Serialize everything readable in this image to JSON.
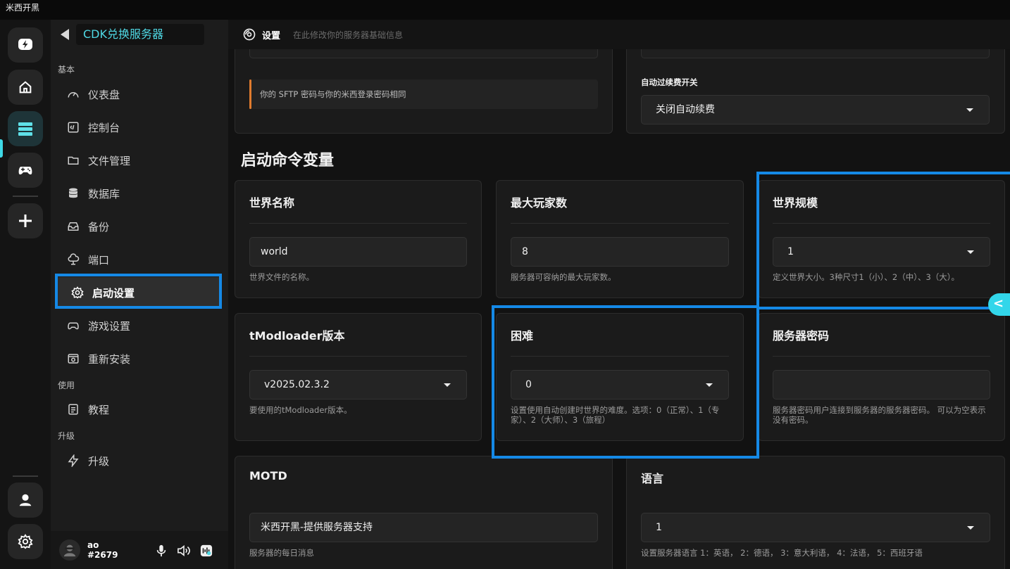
{
  "window": {
    "title": "米西开黑"
  },
  "rail": {
    "items": [
      "lightning",
      "home",
      "servers",
      "games",
      "add",
      "account",
      "settings"
    ]
  },
  "nav": {
    "header": "CDK兑换服务器",
    "sections": {
      "basic": "基本",
      "use": "使用",
      "upgrade": "升级"
    },
    "items": [
      {
        "label": "仪表盘",
        "icon": "gauge-icon"
      },
      {
        "label": "控制台",
        "icon": "console-icon"
      },
      {
        "label": "文件管理",
        "icon": "folder-icon"
      },
      {
        "label": "数据库",
        "icon": "database-icon"
      },
      {
        "label": "备份",
        "icon": "backup-icon"
      },
      {
        "label": "端口",
        "icon": "cloud-port-icon"
      },
      {
        "label": "启动设置",
        "icon": "gear-icon",
        "selected": true
      },
      {
        "label": "游戏设置",
        "icon": "gamepad-icon"
      },
      {
        "label": "重新安装",
        "icon": "reinstall-icon"
      },
      {
        "label": "教程",
        "icon": "tutorial-icon"
      },
      {
        "label": "升级",
        "icon": "bolt-icon"
      }
    ]
  },
  "user": {
    "name": "ao",
    "tag": "#2679"
  },
  "page": {
    "title": "设置",
    "subtitle": "在此修改你的服务器基础信息"
  },
  "top": {
    "sftp_notice": "你的 SFTP 密码与你的米西登录密码相同",
    "auto_renew_label": "自动过续费开关",
    "auto_renew_value": "关闭自动续费"
  },
  "section_title": "启动命令变量",
  "variables": {
    "world_name": {
      "label": "世界名称",
      "value": "world",
      "hint": "世界文件的名称。"
    },
    "max_players": {
      "label": "最大玩家数",
      "value": "8",
      "hint": "服务器可容纳的最大玩家数。"
    },
    "world_size": {
      "label": "世界规模",
      "value": "1",
      "hint": "定义世界大小。3种尺寸1（小）、2（中）、3（大）。"
    },
    "tmod_version": {
      "label": "tModloader版本",
      "value": "v2025.02.3.2",
      "hint": "要使用的tModloader版本。"
    },
    "difficulty": {
      "label": "困难",
      "value": "0",
      "hint": "设置使用自动创建时世界的难度。选项：0（正常）、1（专家）、2（大师）、3（旅程）"
    },
    "server_password": {
      "label": "服务器密码",
      "value": "",
      "hint": "服务器密码用户连接到服务器的服务器密码。 可以为空表示没有密码。"
    },
    "motd": {
      "label": "MOTD",
      "value": "米西开黑-提供服务器支持",
      "hint": "服务器的每日消息"
    },
    "language": {
      "label": "语言",
      "value": "1",
      "hint": "设置服务器语言 1：英语， 2：德语， 3：意大利语， 4：法语， 5：西班牙语"
    }
  },
  "colors": {
    "accent": "#4fd8e4",
    "highlight": "#1589e6",
    "warning_bar": "#e07b2e"
  }
}
